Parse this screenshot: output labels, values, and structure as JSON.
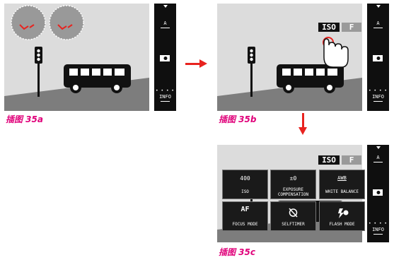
{
  "colors": {
    "accent": "#e8231f",
    "caption": "#e0007a"
  },
  "panel_a": {
    "caption": "插图 35a",
    "side_top": "A",
    "side_bottom": "INFO"
  },
  "panel_b": {
    "caption": "插图 35b",
    "badge_iso": "ISO",
    "badge_f": "F",
    "side_top": "A",
    "side_bottom": "INFO"
  },
  "panel_c": {
    "caption": "插图 35c",
    "badge_iso": "ISO",
    "badge_f": "F",
    "side_top": "A",
    "side_bottom": "INFO",
    "tiles": [
      {
        "value": "400",
        "label": "ISO"
      },
      {
        "value": "±0",
        "label": "EXPOSURE COMPENSATION"
      },
      {
        "value": "AWB",
        "label": "WHITE BALANCE"
      },
      {
        "value": "AF",
        "label": "FOCUS MODE"
      },
      {
        "value": "",
        "label": "SELFTIMER"
      },
      {
        "value": "",
        "label": "FLASH MODE"
      }
    ]
  }
}
